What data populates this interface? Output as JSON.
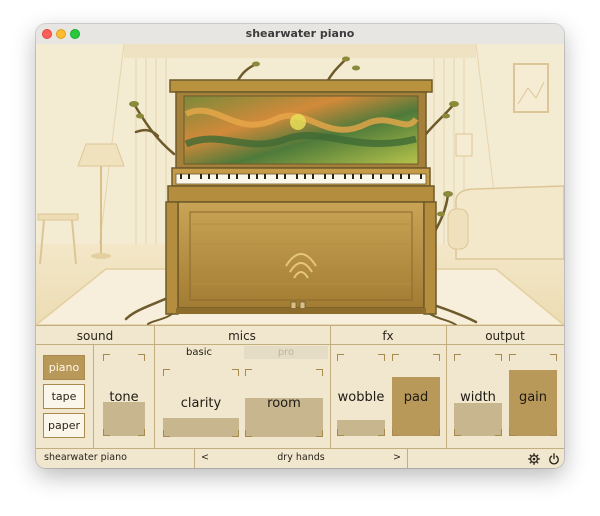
{
  "window": {
    "title": "shearwater piano"
  },
  "sections": {
    "sound": "sound",
    "mics": "mics",
    "fx": "fx",
    "output": "output"
  },
  "sound": {
    "sources": [
      {
        "label": "piano",
        "active": true
      },
      {
        "label": "tape",
        "active": false
      },
      {
        "label": "paper",
        "active": false
      }
    ],
    "tone": {
      "label": "tone",
      "value": 0.42
    }
  },
  "mics": {
    "tabs": [
      {
        "label": "basic",
        "active": true
      },
      {
        "label": "pro",
        "active": false
      }
    ],
    "clarity": {
      "label": "clarity",
      "value": 0.28
    },
    "room": {
      "label": "room",
      "value": 0.58
    }
  },
  "fx": {
    "wobble": {
      "label": "wobble",
      "value": 0.2
    },
    "pad": {
      "label": "pad",
      "value": 0.72
    }
  },
  "output": {
    "width": {
      "label": "width",
      "value": 0.4
    },
    "gain": {
      "label": "gain",
      "value": 0.8
    }
  },
  "footer": {
    "plugin_name": "shearwater piano",
    "prev_icon": "<",
    "preset": "dry hands",
    "next_icon": ">",
    "settings_icon": "gear-icon",
    "power_icon": "power-icon"
  },
  "colors": {
    "fill_light": "#c8b68f",
    "fill_dark": "#b8995a",
    "panel_bg": "#f1e7cf",
    "line": "#c3ae80"
  }
}
